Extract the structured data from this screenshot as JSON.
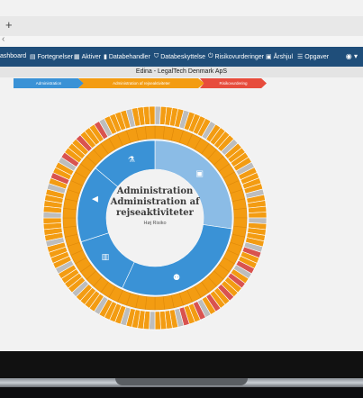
{
  "browser": {
    "new_tab_symbol": "+",
    "back_symbol": "‹"
  },
  "navbar": {
    "items": [
      {
        "icon": "dashboard-icon",
        "glyph": "",
        "label": "ashboard"
      },
      {
        "icon": "list-icon",
        "glyph": "▤",
        "label": "Fortegnelser"
      },
      {
        "icon": "assets-icon",
        "glyph": "▦",
        "label": "Aktiver"
      },
      {
        "icon": "trash-icon",
        "glyph": "▮",
        "label": "Databehandler"
      },
      {
        "icon": "shield-icon",
        "glyph": "⛉",
        "label": "Databeskyttelse"
      },
      {
        "icon": "power-icon",
        "glyph": "⏻",
        "label": "Risikovurderinger"
      },
      {
        "icon": "calendar-icon",
        "glyph": "▣",
        "label": "Årshjul"
      },
      {
        "icon": "tasks-icon",
        "glyph": "☰",
        "label": "Opgaver"
      }
    ],
    "right_glyph": "◉ ▾"
  },
  "subtitle": "Edina - LegalTech Denmark ApS",
  "steps": [
    {
      "label": "Administration",
      "color": "#3a92d6"
    },
    {
      "label": "Administration af rejseaktiviteter",
      "color": "#f39c12"
    },
    {
      "label": "Risikovurdering",
      "color": "#e74c3c"
    }
  ],
  "wheel": {
    "colors": {
      "blue": "#3a92d6",
      "light_blue": "#8bbce6",
      "orange": "#f39c12",
      "red": "#d9534f",
      "grey": "#bdbdbd"
    },
    "icons": [
      "flask-icon",
      "archive-icon",
      "users-icon",
      "building-icon",
      "bullhorn-icon"
    ]
  },
  "center": {
    "line1": "Administration",
    "line2": "Administration af",
    "line3": "rejseaktiviteter",
    "line4": "Høj Risiko"
  }
}
